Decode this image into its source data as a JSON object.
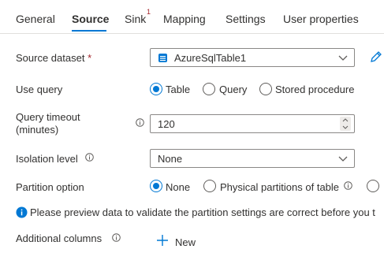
{
  "tabs": [
    {
      "label": "General"
    },
    {
      "label": "Source"
    },
    {
      "label": "Sink",
      "badge": "1"
    },
    {
      "label": "Mapping"
    },
    {
      "label": "Settings"
    },
    {
      "label": "User properties"
    }
  ],
  "colors": {
    "accent": "#0078d4",
    "required": "#a4262c",
    "text": "#323130"
  },
  "source_dataset": {
    "label": "Source dataset",
    "required_mark": "*",
    "value": "AzureSqlTable1",
    "icon": "sql-table-icon"
  },
  "use_query": {
    "label": "Use query",
    "options": [
      "Table",
      "Query",
      "Stored procedure"
    ],
    "selected": "Table"
  },
  "query_timeout": {
    "label_line1": "Query timeout",
    "label_line2": "(minutes)",
    "value": "120"
  },
  "isolation_level": {
    "label": "Isolation level",
    "value": "None"
  },
  "partition_option": {
    "label": "Partition option",
    "options": [
      "None",
      "Physical partitions of table"
    ],
    "selected": "None"
  },
  "info_message": "Please preview data to validate the partition settings are correct before you t",
  "additional_columns": {
    "label": "Additional columns",
    "new_label": "New"
  }
}
